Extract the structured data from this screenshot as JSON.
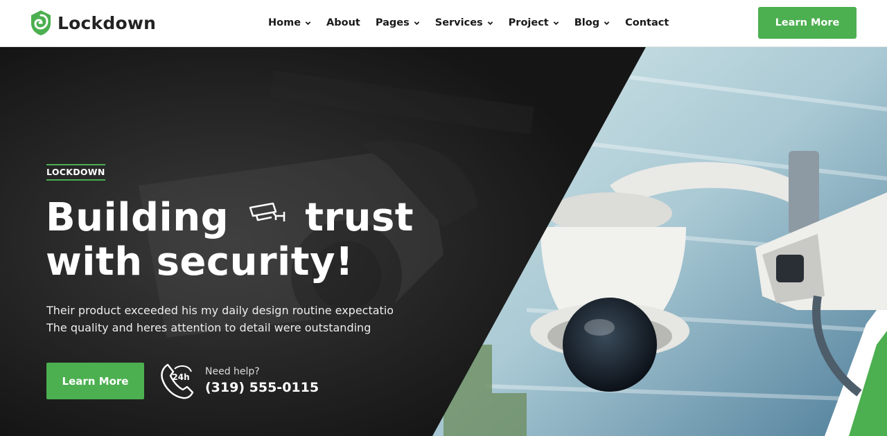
{
  "brand": {
    "name": "Lockdown",
    "accent": "#4caf50"
  },
  "nav": {
    "items": [
      {
        "label": "Home",
        "dropdown": true
      },
      {
        "label": "About",
        "dropdown": false
      },
      {
        "label": "Pages",
        "dropdown": true
      },
      {
        "label": "Services",
        "dropdown": true
      },
      {
        "label": "Project",
        "dropdown": true
      },
      {
        "label": "Blog",
        "dropdown": true
      },
      {
        "label": "Contact",
        "dropdown": false
      }
    ],
    "cta_label": "Learn More"
  },
  "hero": {
    "eyebrow": "LOCKDOWN",
    "headline_1": "Building",
    "headline_2": "trust",
    "headline_3": "with security!",
    "desc_line_1": "Their product exceeded his my daily design routine expectations wa",
    "desc_line_2": "The quality and heres attention to detail were outstanding",
    "cta_label": "Learn More",
    "help_label": "Need help?",
    "help_phone": "(319) 555-0115",
    "help_icon_text": "24h",
    "icons": [
      "security-camera-icon",
      "phone-24h-icon",
      "chevron-down-icon",
      "shield-logo-icon"
    ]
  }
}
